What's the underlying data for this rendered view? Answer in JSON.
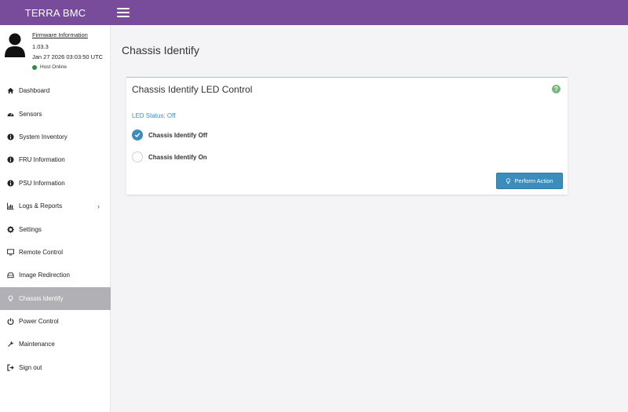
{
  "app": {
    "brand": "TERRA BMC"
  },
  "user_panel": {
    "firmware_link": "Firmware Information",
    "firmware_version": "1.03.3",
    "firmware_date": "Jan 27 2026 03:03:50 UTC",
    "host_status": "Host Online",
    "host_status_color": "#2e8b3f"
  },
  "sidebar": {
    "items": [
      {
        "label": "Dashboard",
        "icon": "home-icon"
      },
      {
        "label": "Sensors",
        "icon": "gauge-icon"
      },
      {
        "label": "System Inventory",
        "icon": "info-icon"
      },
      {
        "label": "FRU Information",
        "icon": "info-icon"
      },
      {
        "label": "PSU Information",
        "icon": "info-icon"
      },
      {
        "label": "Logs & Reports",
        "icon": "bar-chart-icon",
        "has_submenu": true
      },
      {
        "label": "Settings",
        "icon": "gear-icon"
      },
      {
        "label": "Remote Control",
        "icon": "monitor-icon"
      },
      {
        "label": "Image Redirection",
        "icon": "drive-icon"
      },
      {
        "label": "Chassis Identify",
        "icon": "lightbulb-icon",
        "active": true
      },
      {
        "label": "Power Control",
        "icon": "power-icon"
      },
      {
        "label": "Maintenance",
        "icon": "wrench-icon"
      },
      {
        "label": "Sign out",
        "icon": "sign-out-icon"
      }
    ]
  },
  "main": {
    "page_title": "Chassis Identify",
    "card": {
      "title": "Chassis Identify LED Control",
      "led_status": "LED Status: Off",
      "options": [
        {
          "label": "Chassis Identify Off",
          "checked": true
        },
        {
          "label": "Chassis Identify On",
          "checked": false
        }
      ],
      "perform_label": "Perform Action"
    }
  },
  "colors": {
    "topbar": "#784c9b",
    "accent": "#3c8dbc",
    "active_nav": "#b1b1b5",
    "help": "#7ab87d"
  }
}
